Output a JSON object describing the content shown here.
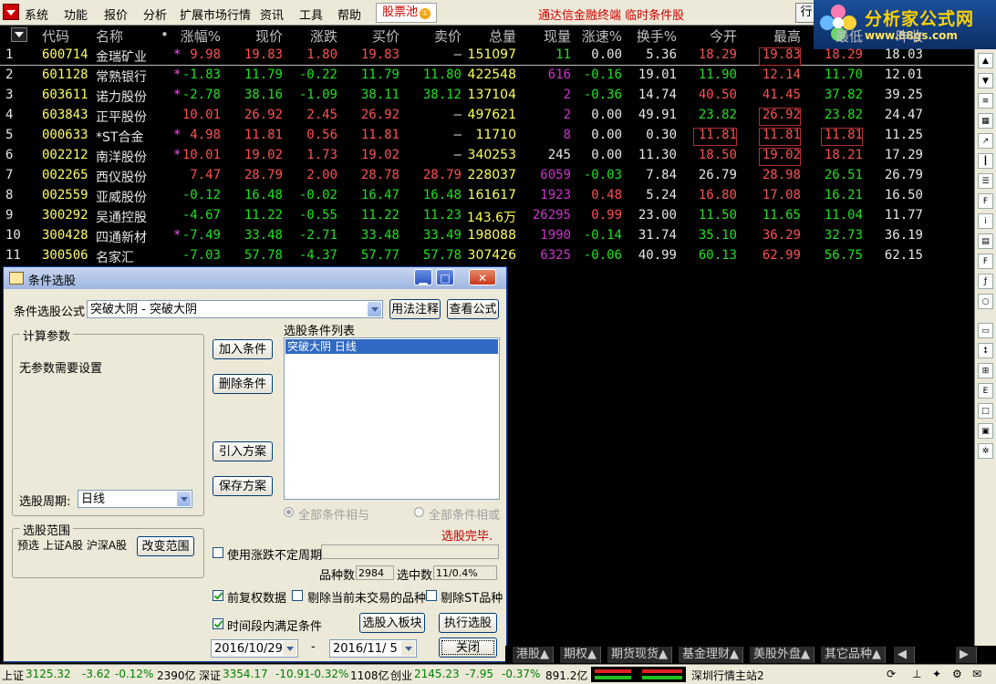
{
  "menu": {
    "items": [
      "系统",
      "功能",
      "报价",
      "分析",
      "扩展市场行情",
      "资讯",
      "工具",
      "帮助"
    ],
    "pool": "股票池",
    "pool_badge": "①",
    "ad": "通达信金融终端   临时条件股",
    "row_btn": "行"
  },
  "logo": {
    "title": "分析家公式网",
    "url": "www.88gs.com"
  },
  "table": {
    "headers": [
      "代码",
      "名称",
      "•",
      "涨幅%",
      "现价",
      "涨跌",
      "买价",
      "卖价",
      "总量",
      "现量",
      "涨速%",
      "换手%",
      "今开",
      "最高",
      "最低",
      "昨收"
    ],
    "rows": [
      {
        "n": "1",
        "code": "600714",
        "name": "金瑞矿业",
        "star": "*",
        "chg_pct": "9.98",
        "price": "19.83",
        "chg": "1.80",
        "bid": "19.83",
        "ask": "—",
        "vol": "151097",
        "cur": "11",
        "speed": "0.00",
        "turn": "5.36",
        "open": "18.29",
        "high": "19.83",
        "low": "18.29",
        "prev": "18.03"
      },
      {
        "n": "2",
        "code": "601128",
        "name": "常熟银行",
        "star": "*",
        "chg_pct": "-1.83",
        "price": "11.79",
        "chg": "-0.22",
        "bid": "11.79",
        "ask": "11.80",
        "vol": "422548",
        "cur": "616",
        "speed": "-0.16",
        "turn": "19.01",
        "open": "11.90",
        "high": "12.14",
        "low": "11.70",
        "prev": "12.01"
      },
      {
        "n": "3",
        "code": "603611",
        "name": "诺力股份",
        "star": "*",
        "chg_pct": "-2.78",
        "price": "38.16",
        "chg": "-1.09",
        "bid": "38.11",
        "ask": "38.12",
        "vol": "137104",
        "cur": "2",
        "speed": "-0.36",
        "turn": "14.74",
        "open": "40.50",
        "high": "41.45",
        "low": "37.82",
        "prev": "39.25"
      },
      {
        "n": "4",
        "code": "603843",
        "name": "正平股份",
        "star": "",
        "chg_pct": "10.01",
        "price": "26.92",
        "chg": "2.45",
        "bid": "26.92",
        "ask": "—",
        "vol": "497621",
        "cur": "2",
        "speed": "0.00",
        "turn": "49.91",
        "open": "23.82",
        "high": "26.92",
        "low": "23.82",
        "prev": "24.47"
      },
      {
        "n": "5",
        "code": "000633",
        "name": "*ST合金",
        "star": "*",
        "chg_pct": "4.98",
        "price": "11.81",
        "chg": "0.56",
        "bid": "11.81",
        "ask": "—",
        "vol": "11710",
        "cur": "8",
        "speed": "0.00",
        "turn": "0.30",
        "open": "11.81",
        "high": "11.81",
        "low": "11.81",
        "prev": "11.25"
      },
      {
        "n": "6",
        "code": "002212",
        "name": "南洋股份",
        "star": "*",
        "chg_pct": "10.01",
        "price": "19.02",
        "chg": "1.73",
        "bid": "19.02",
        "ask": "—",
        "vol": "340253",
        "cur": "245",
        "speed": "0.00",
        "turn": "11.30",
        "open": "18.50",
        "high": "19.02",
        "low": "18.21",
        "prev": "17.29"
      },
      {
        "n": "7",
        "code": "002265",
        "name": "西仪股份",
        "star": "",
        "chg_pct": "7.47",
        "price": "28.79",
        "chg": "2.00",
        "bid": "28.78",
        "ask": "28.79",
        "vol": "228037",
        "cur": "6059",
        "speed": "-0.03",
        "turn": "7.84",
        "open": "26.79",
        "high": "28.98",
        "low": "26.51",
        "prev": "26.79"
      },
      {
        "n": "8",
        "code": "002559",
        "name": "亚威股份",
        "star": "",
        "chg_pct": "-0.12",
        "price": "16.48",
        "chg": "-0.02",
        "bid": "16.47",
        "ask": "16.48",
        "vol": "161617",
        "cur": "1923",
        "speed": "0.48",
        "turn": "5.24",
        "open": "16.80",
        "high": "17.08",
        "low": "16.21",
        "prev": "16.50"
      },
      {
        "n": "9",
        "code": "300292",
        "name": "吴通控股",
        "star": "",
        "chg_pct": "-4.67",
        "price": "11.22",
        "chg": "-0.55",
        "bid": "11.22",
        "ask": "11.23",
        "vol": "143.6万",
        "cur": "26295",
        "speed": "0.99",
        "turn": "23.00",
        "open": "11.50",
        "high": "11.65",
        "low": "11.04",
        "prev": "11.77"
      },
      {
        "n": "10",
        "code": "300428",
        "name": "四通新材",
        "star": "*",
        "chg_pct": "-7.49",
        "price": "33.48",
        "chg": "-2.71",
        "bid": "33.48",
        "ask": "33.49",
        "vol": "198088",
        "cur": "1990",
        "speed": "-0.14",
        "turn": "31.74",
        "open": "35.10",
        "high": "36.29",
        "low": "32.73",
        "prev": "36.19"
      },
      {
        "n": "11",
        "code": "300506",
        "name": "名家汇",
        "star": "",
        "chg_pct": "-7.03",
        "price": "57.78",
        "chg": "-4.37",
        "bid": "57.77",
        "ask": "57.78",
        "vol": "307426",
        "cur": "6325",
        "speed": "-0.06",
        "turn": "40.99",
        "open": "60.13",
        "high": "62.99",
        "low": "56.75",
        "prev": "62.15"
      }
    ]
  },
  "colors": {
    "up": "#ff5050",
    "down": "#20e020",
    "flat": "#e8e8e8",
    "code": "#ffff60",
    "vol": "#ffff60",
    "cur_up": "#cc33cc",
    "star": "#ff50ff"
  },
  "dialog": {
    "title": "条件选股",
    "formula_label": "条件选股公式",
    "formula_value": "突破大阴      - 突破大阴",
    "btn_usage": "用法注释",
    "btn_view": "查看公式",
    "params_group": "计算参数",
    "params_text": "无参数需要设置",
    "btn_add": "加入条件",
    "btn_delete": "删除条件",
    "btn_import": "引入方案",
    "btn_save": "保存方案",
    "cond_list_label": "选股条件列表",
    "cond_items": [
      "突破大阴  日线"
    ],
    "period_label": "选股周期:",
    "period_value": "日线",
    "radio_and": "全部条件相与",
    "radio_or": "全部条件相或",
    "done_text": "选股完毕.",
    "range_group": "选股范围",
    "range_text": "预选 上证A股 沪深A股",
    "btn_change_range": "改变范围",
    "chk_uncertain": "使用涨跌不定周期",
    "varieties_label": "品种数",
    "varieties_value": "2984",
    "selected_label": "选中数",
    "selected_value": "11/0.4%",
    "chk_fq": "前复权数据",
    "chk_exclude_untraded": "剔除当前未交易的品种",
    "chk_exclude_st": "剔除ST品种",
    "chk_period": "时间段内满足条件",
    "btn_to_block": "选股入板块",
    "btn_run": "执行选股",
    "date_from": "2016/10/29",
    "date_sep": "-",
    "date_to": "2016/11/ 5",
    "btn_close": "关闭"
  },
  "tabs": [
    "港股▲",
    "期权▲",
    "期货现货▲",
    "基金理财▲",
    "美股外盘▲",
    "其它品种▲"
  ],
  "status": {
    "sh_label": "上证",
    "sh_index": "3125.32",
    "sh_chg": "-3.62",
    "sh_pct": "-0.12%",
    "sh_amt": "2390亿",
    "sz_label": "深证",
    "sz_index": "3354.17",
    "sz_chg": "-10.91",
    "sz_pct": "-0.32%",
    "sz_amt": "1108亿",
    "cy_label": "创业",
    "cy_index": "2145.23",
    "cy_chg": "-7.95",
    "cy_pct": "-0.37%",
    "cy_amt": "891.2亿",
    "server": "深圳行情主站2"
  }
}
